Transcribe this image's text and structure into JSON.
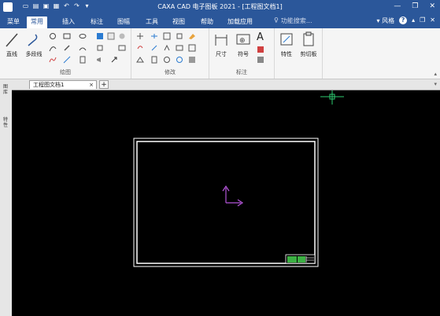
{
  "titlebar": {
    "title": "CAXA CAD 电子图板 2021 - [工程图文档1]",
    "controls": {
      "minimize": "—",
      "restore": "❐",
      "close": "✕"
    }
  },
  "menubar": {
    "tabs": [
      {
        "label": "菜单"
      },
      {
        "label": "常用",
        "active": true
      },
      {
        "label": "插入"
      },
      {
        "label": "标注"
      },
      {
        "label": "图幅"
      },
      {
        "label": "工具"
      },
      {
        "label": "视图"
      },
      {
        "label": "帮助"
      },
      {
        "label": "加载应用"
      }
    ],
    "search_placeholder": "功能搜索...",
    "style_label": "风格"
  },
  "ribbon": {
    "groups": {
      "draw": {
        "label": "绘图",
        "buttons": {
          "line": "直线",
          "polyline": "多段线"
        }
      },
      "modify": {
        "label": "修改"
      },
      "dimension": {
        "label": "标注",
        "buttons": {
          "size": "尺寸",
          "symbol": "符号",
          "text": "A"
        }
      },
      "properties": {
        "buttons": {
          "properties": "特性",
          "clipboard": "剪切板"
        }
      }
    }
  },
  "sidepanel": {
    "tab1": "图库",
    "tab2": "特性"
  },
  "docstrip": {
    "tab_label": "工程图文档1",
    "close": "×",
    "add": "+"
  },
  "colors": {
    "titlebar": "#2b579a",
    "canvas": "#000000",
    "frame": "#ffffff",
    "crosshair": "#2ecc71",
    "ucs": "#b455d9",
    "titleblock_green": "#3cb043"
  }
}
